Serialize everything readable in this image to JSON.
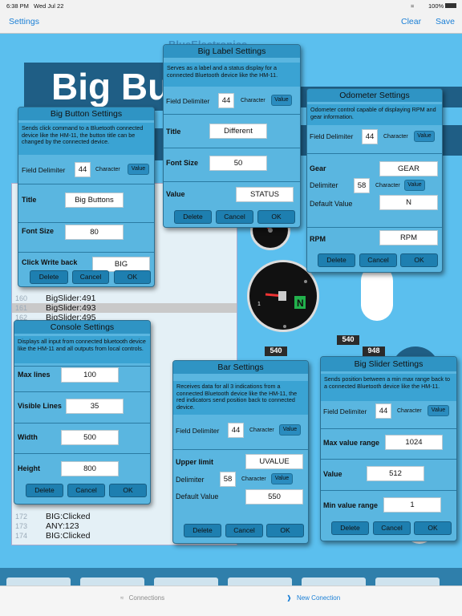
{
  "status_bar": {
    "time": "6:38 PM",
    "date": "Wed Jul 22",
    "battery": "100%"
  },
  "nav": {
    "left": "Settings",
    "clear": "Clear",
    "save": "Save"
  },
  "background": {
    "big_title": "Big Butt",
    "faint_title": "BlueElectronics",
    "console_lines": [
      {
        "n": "160",
        "t": "BigSlider:491"
      },
      {
        "n": "161",
        "t": "BigSlider:493"
      },
      {
        "n": "162",
        "t": "BigSlider:495"
      },
      {
        "n": "172",
        "t": "BIG:Clicked"
      },
      {
        "n": "173",
        "t": "ANY:123"
      },
      {
        "n": "174",
        "t": "BIG:Clicked"
      }
    ],
    "tag1": "540",
    "tag2": "540",
    "tag3": "948"
  },
  "colors": {
    "accent": "#1a7fd6",
    "dialog": "#5ab6e0",
    "dialog_title": "#2f94c4",
    "button": "#1e7fb0",
    "background": "#5bbfee"
  },
  "big_button_settings": {
    "title": "Big Button Settings",
    "description": "Sends click command to a Bluetooth connected device like the HM-11, the button title can be changed by the connected device.",
    "field_delimiter_label": "Field Delimiter",
    "field_delimiter_value": "44",
    "character_label": "Character",
    "value_chip": "Value",
    "title_label": "Title",
    "title_value": "Big Buttons",
    "font_size_label": "Font Size",
    "font_size_value": "80",
    "click_write_back_label": "Click Write back",
    "click_write_back_value": "BIG",
    "delete": "Delete",
    "cancel": "Cancel",
    "ok": "OK"
  },
  "big_label_settings": {
    "title": "Big Label Settings",
    "description": "Serves as a label and a status display for a connected Bluetooth device like the HM-11.",
    "field_delimiter_label": "Field Delimiter",
    "field_delimiter_value": "44",
    "character_label": "Character",
    "value_chip": "Value",
    "title_label": "Title",
    "title_value": "Different",
    "font_size_label": "Font Size",
    "font_size_value": "50",
    "value_label": "Value",
    "value_value": "STATUS",
    "delete": "Delete",
    "cancel": "Cancel",
    "ok": "OK"
  },
  "odometer_settings": {
    "title": "Odometer Settings",
    "description": "Odometer control capable of displaying RPM and gear information.",
    "field_delimiter_label": "Field Delimiter",
    "field_delimiter_value": "44",
    "character_label": "Character",
    "value_chip": "Value",
    "gear_label": "Gear",
    "gear_value": "GEAR",
    "delimiter_label": "Delimiter",
    "delimiter_value": "58",
    "default_value_label": "Default Value",
    "default_value": "N",
    "rpm_label": "RPM",
    "rpm_value": "RPM",
    "delete": "Delete",
    "cancel": "Cancel",
    "ok": "OK"
  },
  "console_settings": {
    "title": "Console Settings",
    "description": "Displays all input from connected bluetooth device like the HM-11 and all outputs from local controls.",
    "max_lines_label": "Max lines",
    "max_lines_value": "100",
    "visible_lines_label": "Visible Lines",
    "visible_lines_value": "35",
    "width_label": "Width",
    "width_value": "500",
    "height_label": "Height",
    "height_value": "800",
    "delete": "Delete",
    "cancel": "Cancel",
    "ok": "OK"
  },
  "bar_settings": {
    "title": "Bar Settings",
    "description": "Receives data for all 3 indications from a connected Bluetooth device like the HM-11, the red indicators send position back to connected device.",
    "field_delimiter_label": "Field Delimiter",
    "field_delimiter_value": "44",
    "character_label": "Character",
    "value_chip": "Value",
    "upper_limit_label": "Upper limit",
    "upper_limit_value": "UVALUE",
    "delimiter_label": "Delimiter",
    "delimiter_value": "58",
    "default_value_label": "Default Value",
    "default_value": "550",
    "delete": "Delete",
    "cancel": "Cancel",
    "ok": "OK"
  },
  "big_slider_settings": {
    "title": "Big Slider Settings",
    "description": "Sends position between a min max range back to a connected Bluetooth device like the HM-11.",
    "field_delimiter_label": "Field Delimiter",
    "field_delimiter_value": "44",
    "character_label": "Character",
    "value_chip": "Value",
    "max_range_label": "Max value range",
    "max_range_value": "1024",
    "value_label": "Value",
    "value_value": "512",
    "min_range_label": "Min value range",
    "min_range_value": "1",
    "delete": "Delete",
    "cancel": "Cancel",
    "ok": "OK"
  },
  "tab_bar": {
    "connections": "Connections",
    "new_connection": "New Conection"
  }
}
